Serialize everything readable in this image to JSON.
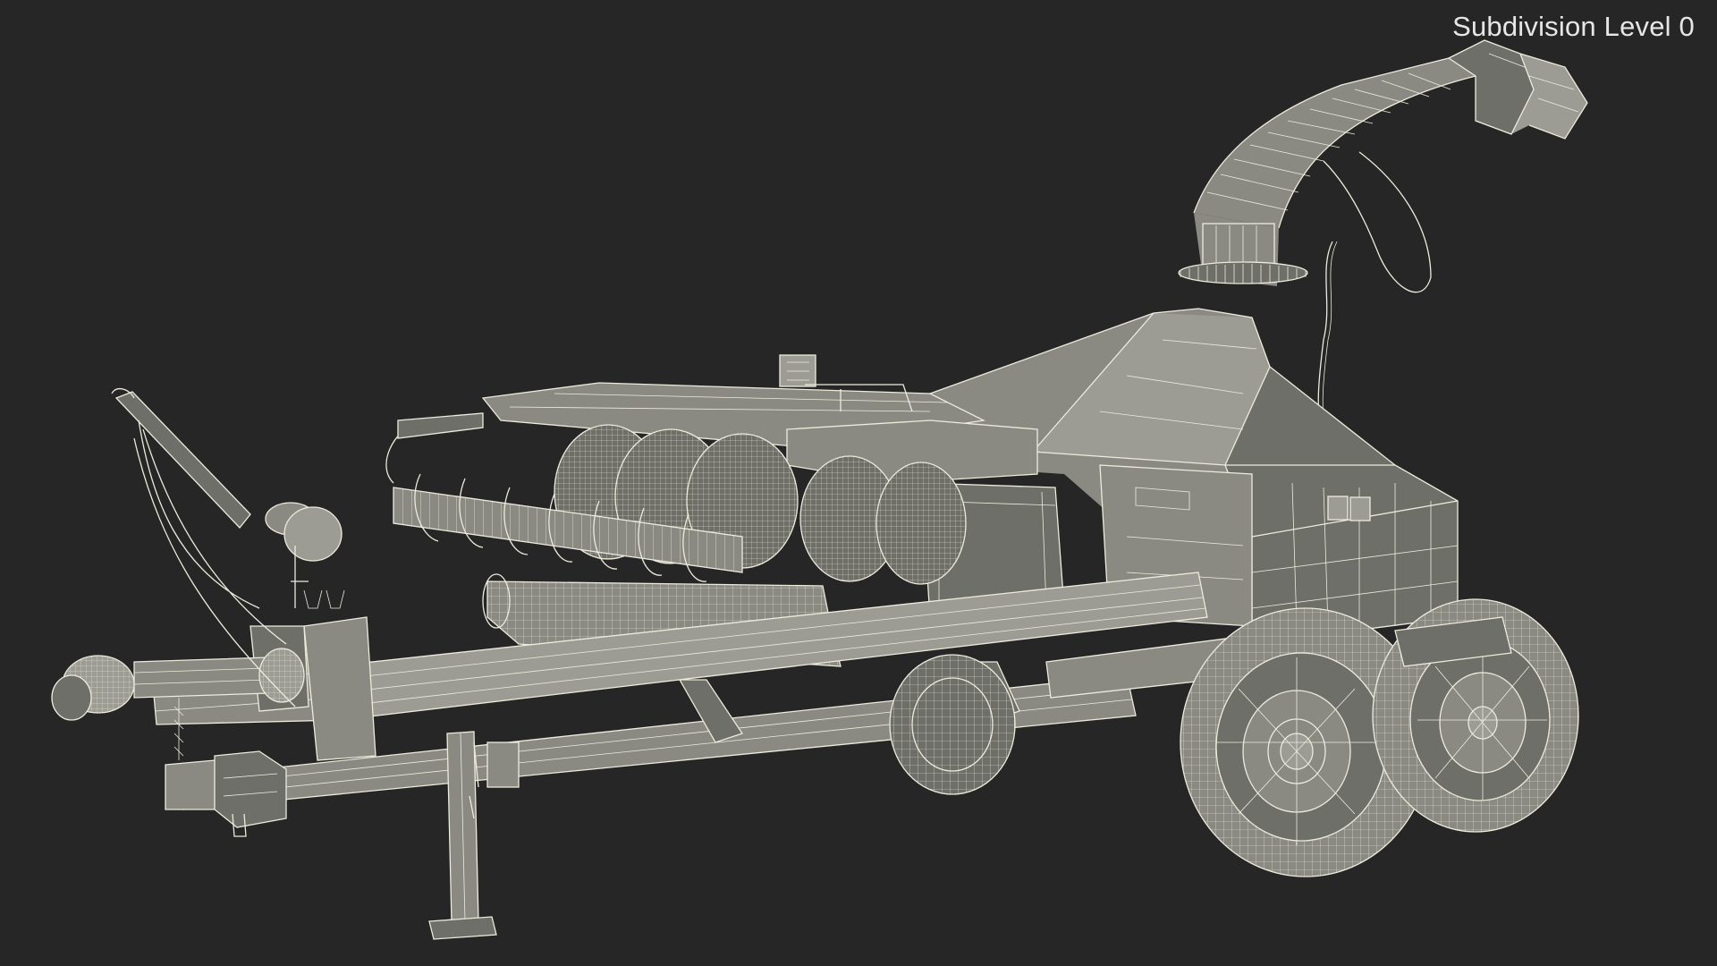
{
  "viewport": {
    "subdivision_label": "Subdivision Level 0"
  },
  "model": {
    "name": "wireframe-forage-harvester",
    "background_color": "#262626",
    "wire_color": "#ecebdc",
    "fill_color": "#8a8a83"
  }
}
